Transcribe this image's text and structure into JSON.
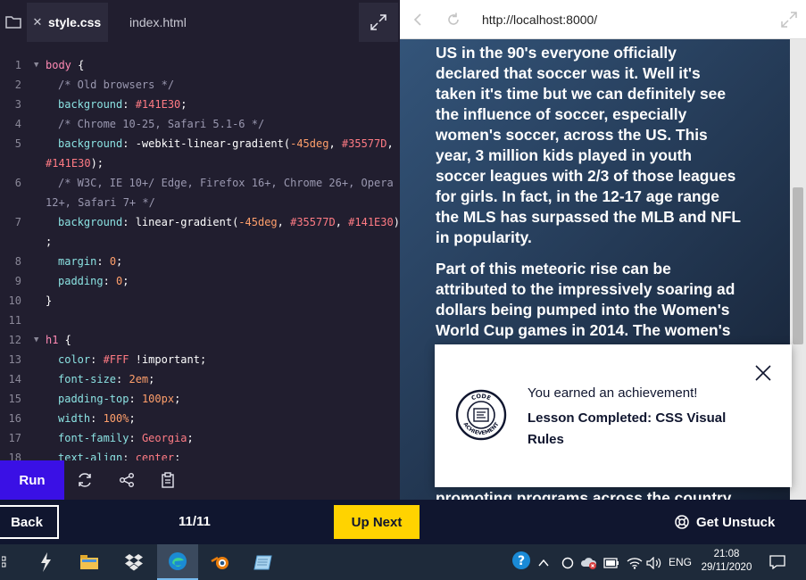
{
  "editor": {
    "tabs": [
      {
        "label": "style.css",
        "active": true
      },
      {
        "label": "index.html",
        "active": false
      }
    ],
    "lines": [
      {
        "n": "1",
        "fold": true,
        "parts": [
          [
            "sel",
            "body"
          ],
          [
            "val",
            " {"
          ]
        ]
      },
      {
        "n": "2",
        "indent": true,
        "parts": [
          [
            "cmt",
            "/* Old browsers */"
          ]
        ]
      },
      {
        "n": "3",
        "indent": true,
        "parts": [
          [
            "prop",
            "background"
          ],
          [
            "val",
            ": "
          ],
          [
            "col",
            "#141E30"
          ],
          [
            "val",
            ";"
          ]
        ]
      },
      {
        "n": "4",
        "indent": true,
        "parts": [
          [
            "cmt",
            "/* Chrome 10-25, Safari 5.1-6 */"
          ]
        ]
      },
      {
        "n": "5",
        "indent": true,
        "parts": [
          [
            "prop",
            "background"
          ],
          [
            "val",
            ": -webkit-linear-gradient("
          ],
          [
            "num-v",
            "-45deg"
          ],
          [
            "val",
            ", "
          ],
          [
            "col",
            "#35577D"
          ],
          [
            "val",
            ","
          ]
        ],
        "cont": [
          [
            "col",
            "#141E30"
          ],
          [
            "val",
            ");"
          ]
        ]
      },
      {
        "n": "6",
        "indent": true,
        "parts": [
          [
            "cmt",
            "/* W3C, IE 10+/ Edge, Firefox 16+, Chrome 26+, Opera"
          ]
        ],
        "cont": [
          [
            "cmt",
            "12+, Safari 7+ */"
          ]
        ]
      },
      {
        "n": "7",
        "indent": true,
        "parts": [
          [
            "prop",
            "background"
          ],
          [
            "val",
            ": linear-gradient("
          ],
          [
            "num-v",
            "-45deg"
          ],
          [
            "val",
            ", "
          ],
          [
            "col",
            "#35577D"
          ],
          [
            "val",
            ", "
          ],
          [
            "col",
            "#141E30"
          ],
          [
            "val",
            ")"
          ]
        ],
        "cont": [
          [
            "val",
            ";"
          ]
        ]
      },
      {
        "n": "8",
        "indent": true,
        "parts": [
          [
            "prop",
            "margin"
          ],
          [
            "val",
            ": "
          ],
          [
            "num-v",
            "0"
          ],
          [
            "val",
            ";"
          ]
        ]
      },
      {
        "n": "9",
        "indent": true,
        "parts": [
          [
            "prop",
            "padding"
          ],
          [
            "val",
            ": "
          ],
          [
            "num-v",
            "0"
          ],
          [
            "val",
            ";"
          ]
        ]
      },
      {
        "n": "10",
        "parts": [
          [
            "val",
            "}"
          ]
        ]
      },
      {
        "n": "11",
        "parts": []
      },
      {
        "n": "12",
        "fold": true,
        "parts": [
          [
            "sel",
            "h1"
          ],
          [
            "val",
            " {"
          ]
        ]
      },
      {
        "n": "13",
        "indent": true,
        "parts": [
          [
            "prop",
            "color"
          ],
          [
            "val",
            ": "
          ],
          [
            "col",
            "#FFF"
          ],
          [
            "val",
            " !important;"
          ]
        ]
      },
      {
        "n": "14",
        "indent": true,
        "parts": [
          [
            "prop",
            "font-size"
          ],
          [
            "val",
            ": "
          ],
          [
            "num-v",
            "2em"
          ],
          [
            "val",
            ";"
          ]
        ]
      },
      {
        "n": "15",
        "indent": true,
        "parts": [
          [
            "prop",
            "padding-top"
          ],
          [
            "val",
            ": "
          ],
          [
            "num-v",
            "100px"
          ],
          [
            "val",
            ";"
          ]
        ]
      },
      {
        "n": "16",
        "indent": true,
        "parts": [
          [
            "prop",
            "width"
          ],
          [
            "val",
            ": "
          ],
          [
            "num-v",
            "100%"
          ],
          [
            "val",
            ";"
          ]
        ]
      },
      {
        "n": "17",
        "indent": true,
        "parts": [
          [
            "prop",
            "font-family"
          ],
          [
            "val",
            ": "
          ],
          [
            "col",
            "Georgia"
          ],
          [
            "val",
            ";"
          ]
        ]
      },
      {
        "n": "18",
        "indent": true,
        "parts": [
          [
            "prop",
            "text-align"
          ],
          [
            "val",
            ": "
          ],
          [
            "col",
            "center"
          ],
          [
            "val",
            ";"
          ]
        ]
      }
    ],
    "run_label": "Run"
  },
  "browser": {
    "url": "http://localhost:8000/",
    "paragraph1_lines": [
      "US in the 90's everyone officially",
      "declared that soccer was it. Well it's",
      "taken it's time but we can definitely see",
      "the influence of soccer, especially",
      "women's soccer, across the US. This",
      "year, 3 million kids played in youth",
      "soccer leagues with 2/3 of those leagues",
      "for girls. In fact, in the 12-17 age range",
      "the MLS has surpassed the MLB and NFL",
      "in popularity."
    ],
    "paragraph2_lines": [
      "Part of this meteoric rise can be",
      "attributed to the impressively soaring ad",
      "dollars being pumped into the Women's",
      "World Cup games in 2014. The women's"
    ],
    "hidden_tail_line": "promoting programs across the country"
  },
  "toast": {
    "line1": "You earned an achievement!",
    "line2": "Lesson Completed: CSS Visual Rules",
    "badge_text_top": "CODE",
    "badge_text_bottom": "ACHIEVEMENT"
  },
  "bottom_nav": {
    "back_label": "Back",
    "progress": "11/11",
    "up_next_label": "Up Next",
    "get_unstuck_label": "Get Unstuck"
  },
  "taskbar": {
    "language": "ENG",
    "time": "21:08",
    "date": "29/11/2020"
  },
  "colors": {
    "editor_bg": "#211e2f",
    "run_button": "#3a10e5",
    "up_next_button": "#ffd300",
    "bottom_bar": "#10162f",
    "gradient_start": "#35577d",
    "gradient_end": "#141e30"
  }
}
